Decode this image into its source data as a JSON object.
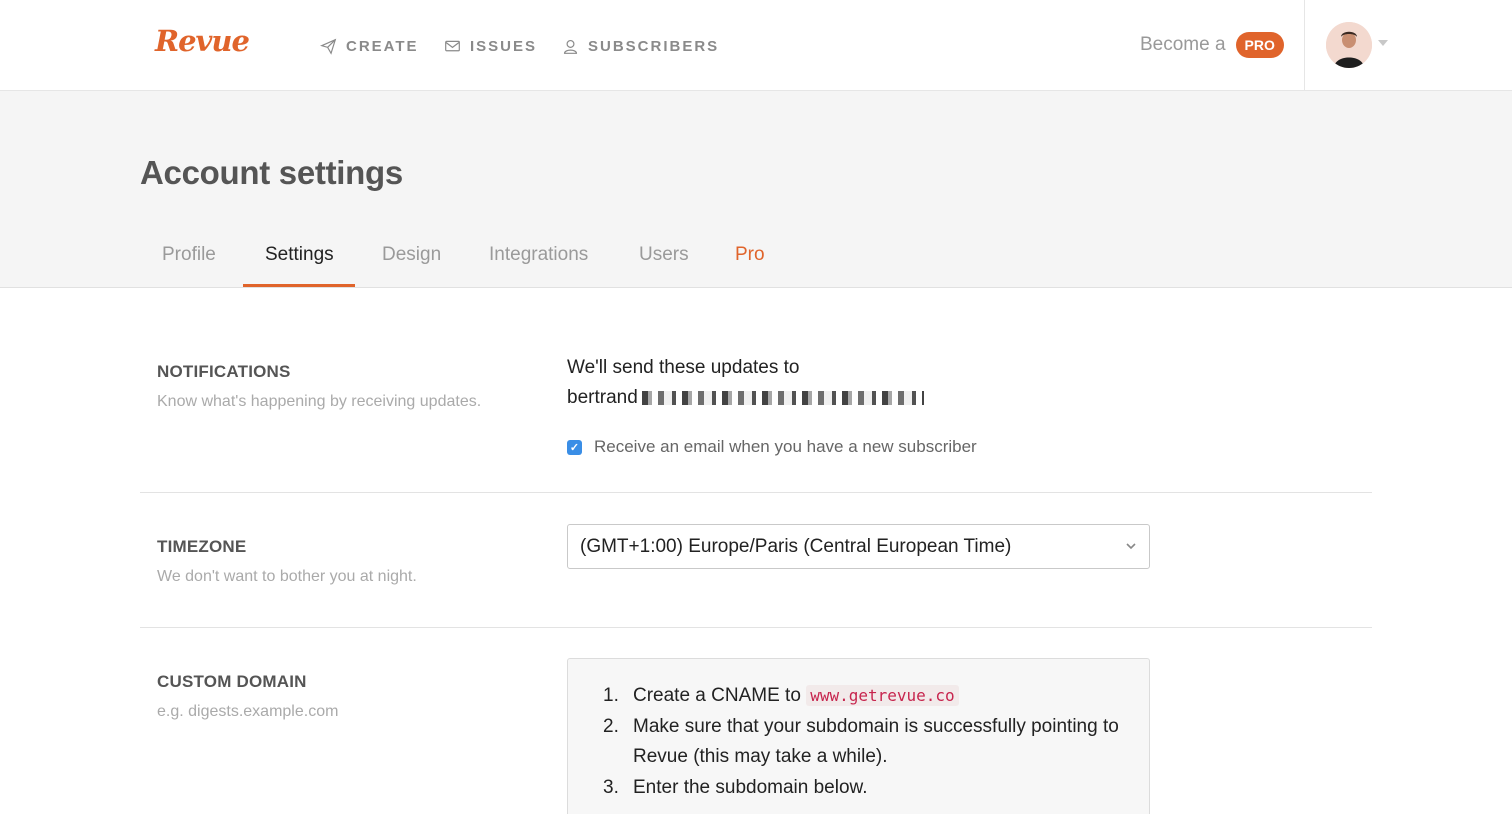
{
  "app": {
    "logo": "Revue",
    "accent_color": "#e0642b"
  },
  "nav": {
    "create": "CREATE",
    "issues": "ISSUES",
    "subscribers": "SUBSCRIBERS",
    "become": "Become a",
    "pro_badge": "PRO"
  },
  "page": {
    "title": "Account settings",
    "tabs": [
      {
        "label": "Profile",
        "state": "inactive"
      },
      {
        "label": "Settings",
        "state": "active"
      },
      {
        "label": "Design",
        "state": "inactive"
      },
      {
        "label": "Integrations",
        "state": "inactive"
      },
      {
        "label": "Users",
        "state": "inactive"
      },
      {
        "label": "Pro",
        "state": "highlight"
      }
    ]
  },
  "notifications": {
    "title": "NOTIFICATIONS",
    "description": "Know what's happening by receiving updates.",
    "send_to_line": "We'll send these updates to",
    "email_prefix": "bertrand",
    "checkbox_label": "Receive an email when you have a new subscriber",
    "checkbox_checked": true
  },
  "timezone": {
    "title": "TIMEZONE",
    "description": "We don't want to bother you at night.",
    "selected": "(GMT+1:00) Europe/Paris (Central European Time)"
  },
  "custom_domain": {
    "title": "CUSTOM DOMAIN",
    "description": "e.g. digests.example.com",
    "steps": {
      "n1": "1.",
      "s1_text": "Create a CNAME to",
      "s1_code": "www.getrevue.co",
      "n2": "2.",
      "s2_text": "Make sure that your subdomain is successfully pointing to Revue (this may take a while).",
      "n3": "3.",
      "s3_text": "Enter the subdomain below."
    }
  }
}
